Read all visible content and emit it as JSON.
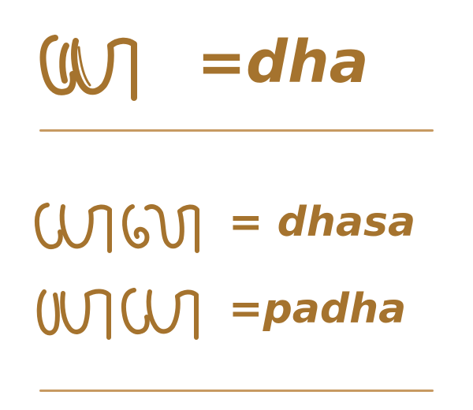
{
  "colors": {
    "brown": "#a5732e",
    "rule": "#c79a62",
    "background": "#ffffff"
  },
  "examples": {
    "dha": {
      "text": "=dha",
      "glyphs": [
        "javanese-dha-icon"
      ]
    },
    "dhasa": {
      "text": "= dhasa",
      "glyphs": [
        "javanese-dha-icon",
        "javanese-sa-icon"
      ]
    },
    "padha": {
      "text": "=padha",
      "glyphs": [
        "javanese-pa-icon",
        "javanese-dha-icon"
      ]
    }
  }
}
